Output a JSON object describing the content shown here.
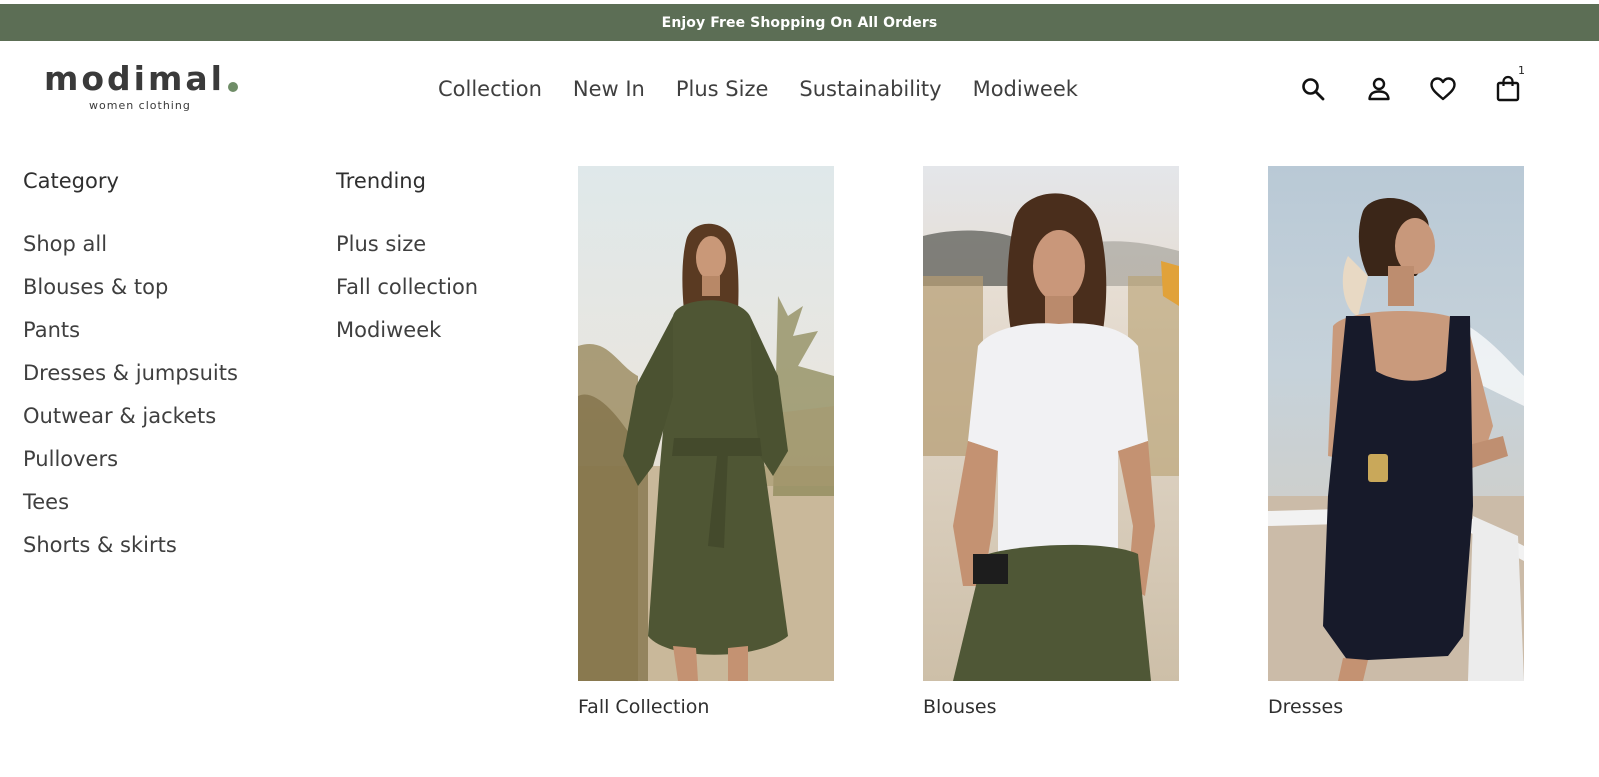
{
  "announcement": "Enjoy Free Shopping On All Orders",
  "logo": {
    "name": "modimal",
    "tagline": "women clothing"
  },
  "nav": [
    "Collection",
    "New In",
    "Plus Size",
    "Sustainability",
    "Modiweek"
  ],
  "header_icons": [
    "search-icon",
    "account-icon",
    "heart-icon",
    "bag-icon"
  ],
  "cart_count": "1",
  "category": {
    "title": "Category",
    "items": [
      "Shop all",
      "Blouses & top",
      "Pants",
      "Dresses & jumpsuits",
      "Outwear & jackets",
      "Pullovers",
      "Tees",
      "Shorts & skirts"
    ]
  },
  "trending": {
    "title": "Trending",
    "items": [
      "Plus size",
      "Fall collection",
      "Modiweek"
    ]
  },
  "cards": [
    {
      "caption": "Fall Collection"
    },
    {
      "caption": "Blouses"
    },
    {
      "caption": "Dresses"
    }
  ],
  "colors": {
    "brand_green": "#5c6e55",
    "text": "#3a3a3a",
    "logo_dot": "#6f8d67"
  }
}
